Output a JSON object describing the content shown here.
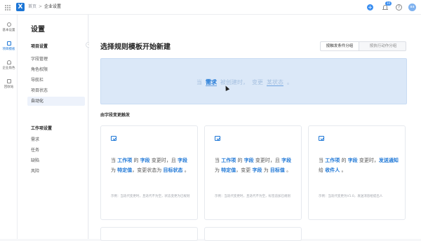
{
  "topbar": {
    "logo": "X",
    "breadcrumbs": [
      "首页",
      "企业设置"
    ],
    "separator": ">",
    "plus": "+",
    "badge_count": "10",
    "help": "?",
    "avatar": "aa"
  },
  "leftnav": {
    "items": [
      {
        "label": "基本设置"
      },
      {
        "label": "项目模板"
      },
      {
        "label": "企业角色"
      },
      {
        "label": "回收站"
      }
    ]
  },
  "subnav": {
    "title": "设置",
    "project_group": "项目设置",
    "project_items": [
      "字段管理",
      "角色权限",
      "导航栏",
      "项目状态",
      "自动化"
    ],
    "workitem_group": "工作项设置",
    "workitem_items": [
      "需求",
      "任务",
      "缺陷",
      "风险"
    ],
    "collapse": "‹"
  },
  "main": {
    "title": "选择规则模板开始新建",
    "tabs": [
      "按触发条件分组",
      "按执行动作分组"
    ],
    "banner": {
      "parts": [
        "当",
        "需求",
        "被创建时，",
        "变更",
        "某状态",
        "。"
      ]
    },
    "section_label": "由字段变更触发",
    "cards": [
      {
        "segments": [
          {
            "t": "当 ",
            "k": false
          },
          {
            "t": "工作项",
            "k": true
          },
          {
            "t": " 的 ",
            "k": false
          },
          {
            "t": "字段",
            "k": true
          },
          {
            "t": " 变更时，且 ",
            "k": false
          },
          {
            "t": "字段",
            "k": true
          },
          {
            "t": " 为 ",
            "k": false
          },
          {
            "t": "特定值",
            "k": true
          },
          {
            "t": "，变更状态为 ",
            "k": false
          },
          {
            "t": "目标状态",
            "k": true
          },
          {
            "t": " 。",
            "k": false
          }
        ],
        "example": "示例：当迭代变更时，且迭代不为空，状态变更为已规划"
      },
      {
        "segments": [
          {
            "t": "当 ",
            "k": false
          },
          {
            "t": "工作项",
            "k": true
          },
          {
            "t": " 的 ",
            "k": false
          },
          {
            "t": "字段",
            "k": true
          },
          {
            "t": " 变更时，且 ",
            "k": false
          },
          {
            "t": "字段",
            "k": true
          },
          {
            "t": " 为 ",
            "k": false
          },
          {
            "t": "特定值",
            "k": true
          },
          {
            "t": "，变更 ",
            "k": false
          },
          {
            "t": "字段",
            "k": true
          },
          {
            "t": " 为 ",
            "k": false
          },
          {
            "t": "目标值",
            "k": true
          },
          {
            "t": " 。",
            "k": false
          }
        ],
        "example": "示例：当迭代变更时，且迭代不为空，标签追加已规划"
      },
      {
        "segments": [
          {
            "t": "当 ",
            "k": false
          },
          {
            "t": "工作项",
            "k": true
          },
          {
            "t": " 的 ",
            "k": false
          },
          {
            "t": "字段",
            "k": true
          },
          {
            "t": " 变更时，",
            "k": false
          },
          {
            "t": "发送通知",
            "k": true
          },
          {
            "t": " 给 ",
            "k": false
          },
          {
            "t": "收件人",
            "k": true
          },
          {
            "t": " 。",
            "k": false
          }
        ],
        "example": "示例：当迭代变更为V1.0，发送消息给提出人"
      }
    ]
  }
}
